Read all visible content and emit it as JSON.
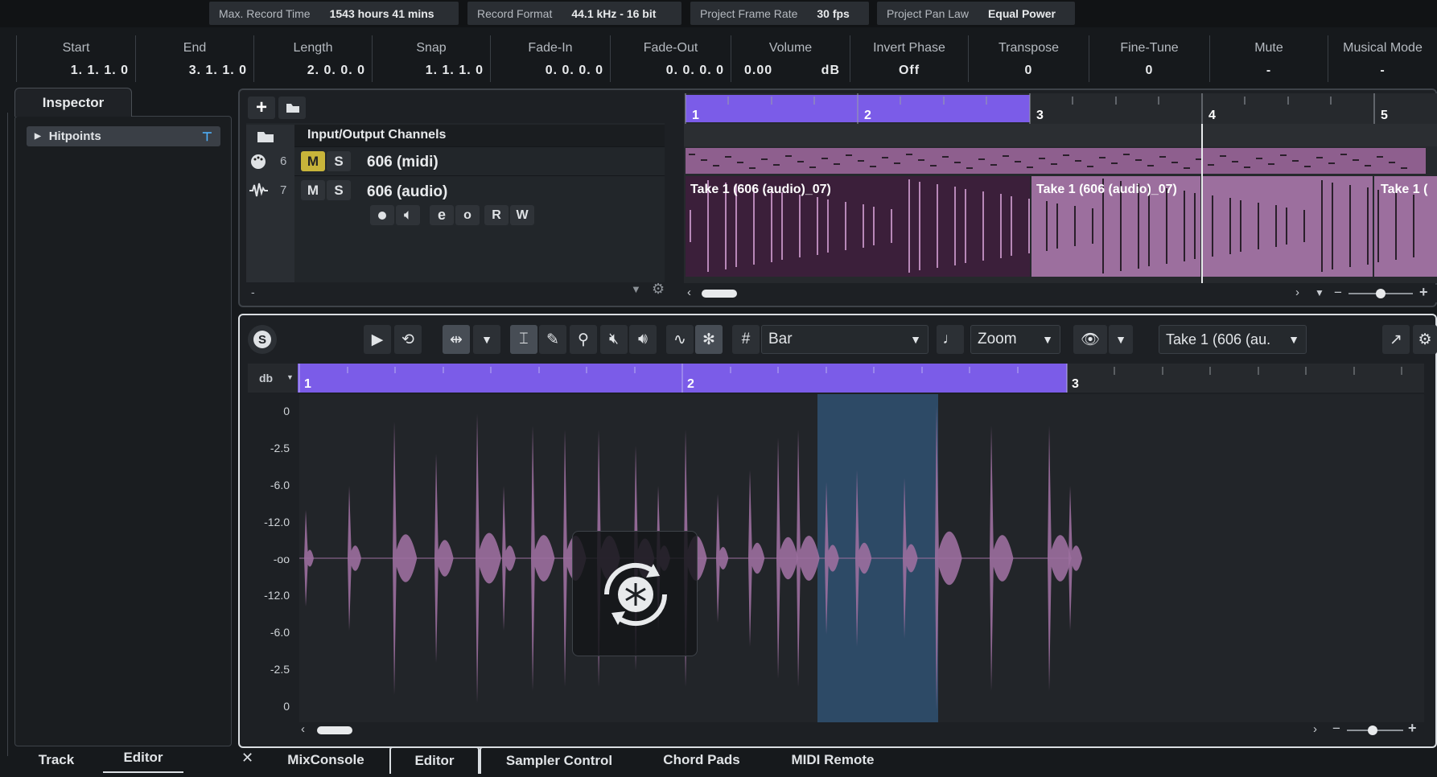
{
  "status_bar": [
    {
      "label": "Max. Record Time",
      "value": "1543 hours 41 mins"
    },
    {
      "label": "Record Format",
      "value": "44.1 kHz - 16 bit"
    },
    {
      "label": "Project Frame Rate",
      "value": "30 fps"
    },
    {
      "label": "Project Pan Law",
      "value": "Equal Power"
    }
  ],
  "info_line": [
    {
      "label": "Start",
      "value": "1. 1. 1.   0"
    },
    {
      "label": "End",
      "value": "3. 1. 1.   0"
    },
    {
      "label": "Length",
      "value": "2. 0. 0.   0"
    },
    {
      "label": "Snap",
      "value": "1. 1. 1.   0"
    },
    {
      "label": "Fade-In",
      "value": "0. 0. 0.   0"
    },
    {
      "label": "Fade-Out",
      "value": "0. 0. 0.   0"
    },
    {
      "label": "Volume",
      "value": "0.00",
      "unit": "dB"
    },
    {
      "label": "Invert Phase",
      "value": "Off"
    },
    {
      "label": "Transpose",
      "value": "0"
    },
    {
      "label": "Fine-Tune",
      "value": "0"
    },
    {
      "label": "Mute",
      "value": "-"
    },
    {
      "label": "Musical Mode",
      "value": "-"
    }
  ],
  "inspector": {
    "tab": "Inspector",
    "section": "Hitpoints"
  },
  "tracks": {
    "folder": "Input/Output Channels",
    "rows": [
      {
        "number": "6",
        "name": "606 (midi)",
        "mute": "M",
        "solo": "S"
      },
      {
        "number": "7",
        "name": "606 (audio)",
        "mute": "M",
        "solo": "S",
        "rw": [
          "R",
          "W"
        ]
      }
    ],
    "minus": "-"
  },
  "arrange": {
    "ruler": [
      "1",
      "2",
      "3",
      "4",
      "5"
    ],
    "events": [
      "Take 1 (606 (audio)_07)",
      "Take 1 (606 (audio)_07)",
      "Take 1 ("
    ]
  },
  "editor": {
    "snap_mode": "Bar",
    "zoom": "Zoom",
    "event_select": "Take 1 (606 (au.",
    "ruler": [
      "1",
      "2",
      "3"
    ],
    "db_label": "db",
    "db_scale": [
      "0",
      "-2.5",
      "-6.0",
      "-12.0",
      "-oo",
      "-12.0",
      "-6.0",
      "-2.5",
      "0"
    ]
  },
  "bottom_tabs_left": [
    "Track",
    "Editor"
  ],
  "bottom_tabs": [
    "MixConsole",
    "Editor",
    "Sampler Control",
    "Chord Pads",
    "MIDI Remote"
  ],
  "colors": {
    "accent": "#7b5ce8",
    "event": "#9c6f9e",
    "selection": "#2d4a66"
  }
}
